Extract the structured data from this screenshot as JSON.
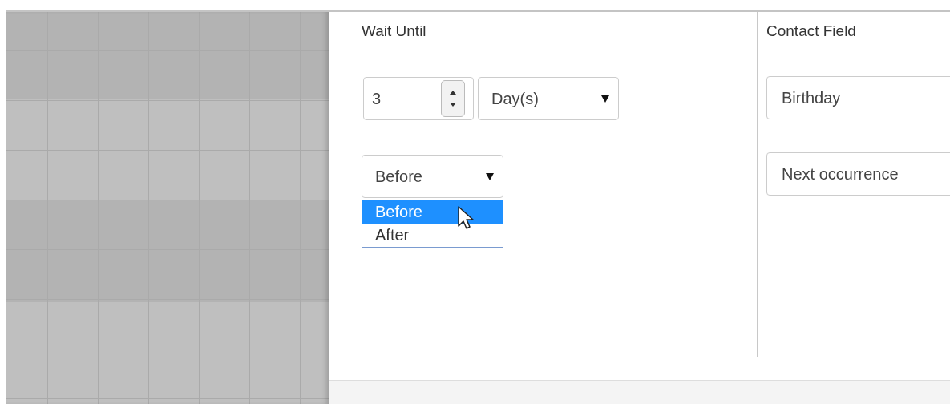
{
  "wait_until": {
    "label": "Wait Until",
    "amount": {
      "value": "3"
    },
    "unit": {
      "value": "Day(s)"
    },
    "relation": {
      "value": "Before",
      "expanded": true,
      "options": [
        {
          "label": "Before",
          "selected": true
        },
        {
          "label": "After",
          "selected": false
        }
      ]
    }
  },
  "contact_field": {
    "label": "Contact Field",
    "field": {
      "value": "Birthday"
    },
    "occurrence": {
      "value": "Next occurrence"
    }
  }
}
